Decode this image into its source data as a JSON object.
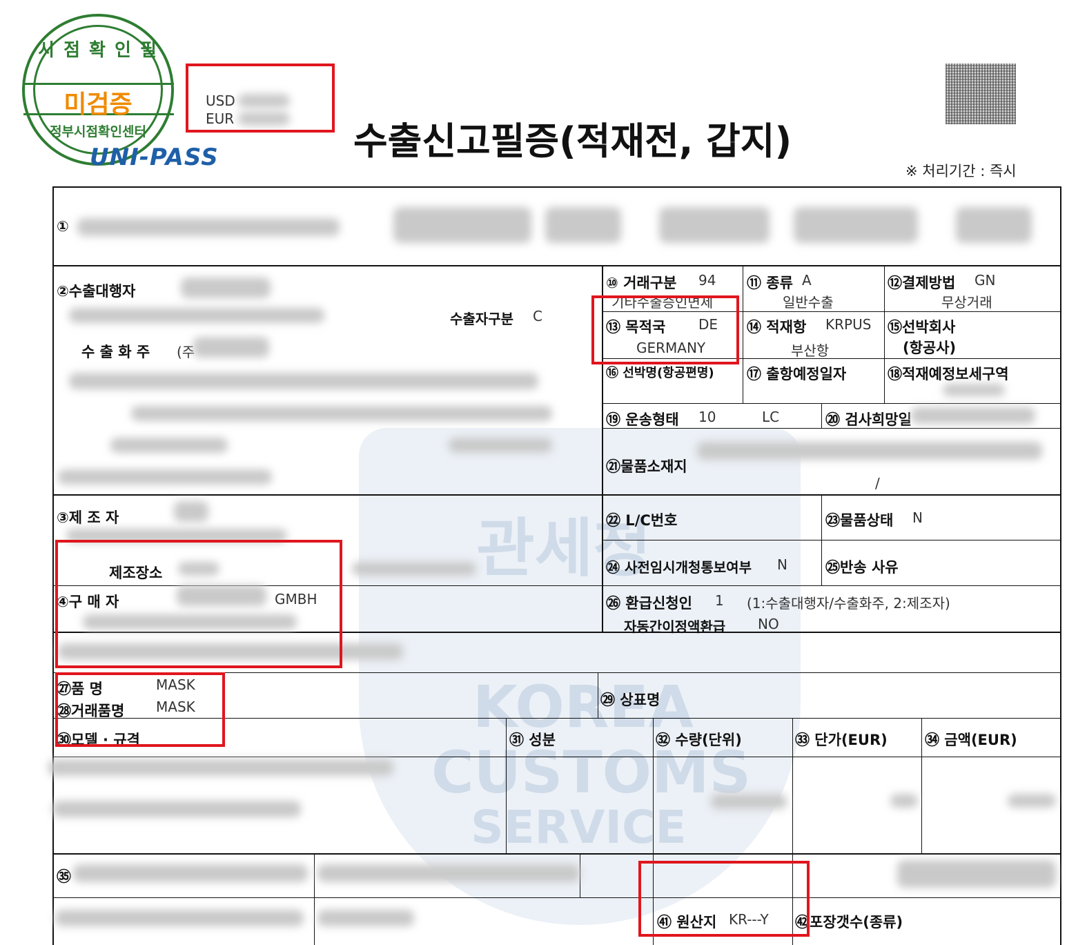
{
  "header": {
    "stamp_top": "시 점 확 인 필",
    "stamp_center": "미검증",
    "stamp_bottom": "정부시점확인센터",
    "logo_text": "UNI-PASS",
    "usd_label": "USD",
    "eur_label": "EUR",
    "title": "수출신고필증(적재전, 갑지)",
    "processing_period": "※ 처리기간 : 즉시"
  },
  "watermark": {
    "line1": "관세청",
    "line2": "KOREA",
    "line3": "CUSTOMS",
    "line4": "SERVICE"
  },
  "left": {
    "f1_label": "①",
    "f2_label": "②수출대행자",
    "exporter_type_label": "수출자구분",
    "exporter_type_value": "C",
    "shipper_label": "수 출 화 주",
    "shipper_value_prefix": "(주",
    "f3_label": "③제   조   자",
    "mfg_place_label": "제조장소",
    "f4_label": "④구   매   자",
    "buyer_value": "GMBH",
    "f27_label": "㉗품      명",
    "f27_value": "MASK",
    "f28_label": "㉘거래품명",
    "f28_value": "MASK",
    "f30_label": "㉚모델 · 규격",
    "f31_label": "㉛ 성분",
    "f32_label": "㉜ 수량(단위)",
    "f33_label": "㉝ 단가(EUR)",
    "f34_label": "㉞ 금액(EUR)",
    "f29_label": "㉙ 상표명",
    "f35_label": "㉟",
    "f41_label": "㊶ 원산지",
    "f41_value": "KR---Y",
    "f42_label": "㊷포장갯수(종류)"
  },
  "right": {
    "f10_label": "⑩ 거래구분",
    "f10_code": "94",
    "f10_desc": "기타수출승인면제",
    "f11_label": "⑪ 종류",
    "f11_code": "A",
    "f11_desc": "일반수출",
    "f12_label": "⑫결제방법",
    "f12_code": "GN",
    "f12_desc": "무상거래",
    "f13_label": "⑬ 목적국",
    "f13_code": "DE",
    "f13_desc": "GERMANY",
    "f14_label": "⑭ 적재항",
    "f14_code": "KRPUS",
    "f14_desc": "부산항",
    "f15_label": "⑮선박회사",
    "f15_label2": "(항공사)",
    "f16_label": "⑯ 선박명(항공편명)",
    "f17_label": "⑰ 출항예정일자",
    "f18_label": "⑱적재예정보세구역",
    "f19_label": "⑲ 운송형태",
    "f19_code": "10",
    "f19_desc": "LC",
    "f20_label": "⑳ 검사희망일",
    "f21_label": "㉑물품소재지",
    "f21_value": "/",
    "f22_label": "㉒ L/C번호",
    "f23_label": "㉓물품상태",
    "f23_value": "N",
    "f24_label": "㉔ 사전임시개청통보여부",
    "f24_value": "N",
    "f25_label": "㉕반송 사유",
    "f26_label": "㉖ 환급신청인",
    "f26_value": "1",
    "f26_desc": "(1:수출대행자/수출화주, 2:제조자)",
    "auto_refund_label": "자동간이정액환급",
    "auto_refund_value": "NO"
  },
  "colors": {
    "highlight": "#e0161e",
    "stamp_green": "#2e7d32",
    "stamp_orange": "#f08a00",
    "logo_blue": "#1f5fa8"
  }
}
